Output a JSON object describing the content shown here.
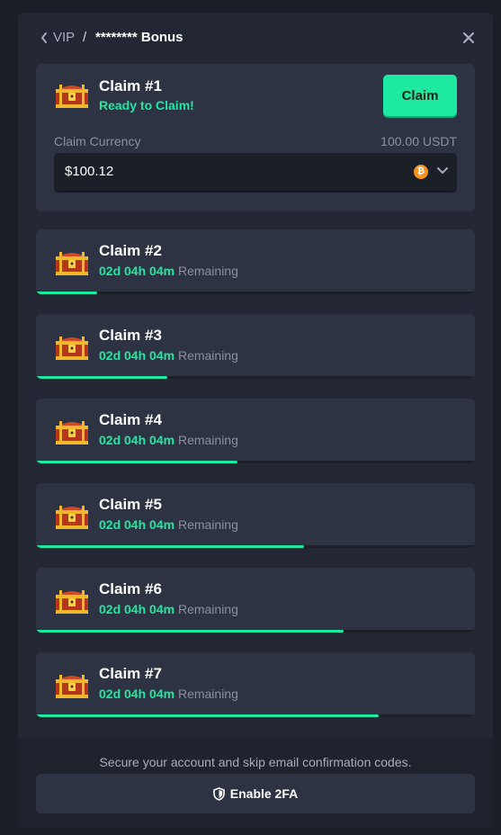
{
  "header": {
    "breadcrumb_root": "VIP",
    "breadcrumb_sep": "/",
    "title": "******** Bonus"
  },
  "claim_one": {
    "title": "Claim #1",
    "status": "Ready to Claim!",
    "claim_label": "Claim",
    "currency_label": "Claim Currency",
    "currency_amount": "100.00 USDT",
    "currency_value": "$100.12",
    "currency_icon": "bitcoin-icon"
  },
  "claims": [
    {
      "title": "Claim #2",
      "time": "02d 04h 04m",
      "remaining": "Remaining",
      "progress": 0.14
    },
    {
      "title": "Claim #3",
      "time": "02d 04h 04m",
      "remaining": "Remaining",
      "progress": 0.3
    },
    {
      "title": "Claim #4",
      "time": "02d 04h 04m",
      "remaining": "Remaining",
      "progress": 0.46
    },
    {
      "title": "Claim #5",
      "time": "02d 04h 04m",
      "remaining": "Remaining",
      "progress": 0.61
    },
    {
      "title": "Claim #6",
      "time": "02d 04h 04m",
      "remaining": "Remaining",
      "progress": 0.7
    },
    {
      "title": "Claim #7",
      "time": "02d 04h 04m",
      "remaining": "Remaining",
      "progress": 0.78
    }
  ],
  "footer": {
    "message": "Secure your account and skip email confirmation codes.",
    "enable_label": "Enable 2FA"
  },
  "colors": {
    "accent": "#1de9a0",
    "background": "#232733",
    "card": "#2e3344",
    "muted": "#8a90a2"
  }
}
